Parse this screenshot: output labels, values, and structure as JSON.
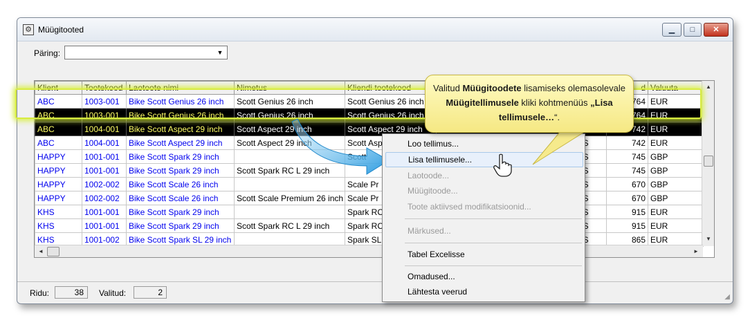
{
  "window": {
    "title": "Müügitooted",
    "minimize": "▁",
    "maximize": "□",
    "close": "✕"
  },
  "query": {
    "label": "Päring:",
    "value": ""
  },
  "grid": {
    "columns": [
      "Klient",
      "Tootekood",
      "Laotoote nimi",
      "Nimetus",
      "Kliendi tootekood",
      "",
      "",
      "d",
      "Valuuta"
    ],
    "rows": [
      {
        "klient": "ABC",
        "kood": "1003-001",
        "laonimi": "Bike Scott Genius 26 inch",
        "nimetus": "Scott Genius 26 inch",
        "kkood": "Scott Genius 26 inch",
        "c": "",
        "hind": "764",
        "valuuta": "EUR"
      },
      {
        "klient": "ABC",
        "kood": "1003-001",
        "laonimi": "Bike Scott Genius 26 inch",
        "nimetus": "Scott Genius 26 inch",
        "kkood": "Scott Genius 26 inch",
        "c": "",
        "hind": "764",
        "valuuta": "EUR"
      },
      {
        "klient": "ABC",
        "kood": "1004-001",
        "laonimi": "Bike Scott Aspect 29 inch",
        "nimetus": "Scott Aspect 29 inch",
        "kkood": "Scott Aspect 29 inch",
        "c": "",
        "hind": "742",
        "valuuta": "EUR"
      },
      {
        "klient": "ABC",
        "kood": "1004-001",
        "laonimi": "Bike Scott Aspect 29 inch",
        "nimetus": "Scott Aspect 29 inch",
        "kkood": "Scott Asp",
        "c": "CS",
        "hind": "742",
        "valuuta": "EUR"
      },
      {
        "klient": "HAPPY",
        "kood": "1001-001",
        "laonimi": "Bike Scott Spark 29 inch",
        "nimetus": "",
        "kkood": "Scott",
        "c": "CS",
        "hind": "745",
        "valuuta": "GBP"
      },
      {
        "klient": "HAPPY",
        "kood": "1001-001",
        "laonimi": "Bike Scott Spark 29 inch",
        "nimetus": "Scott Spark RC L 29 inch",
        "kkood": "",
        "c": "CS",
        "hind": "745",
        "valuuta": "GBP"
      },
      {
        "klient": "HAPPY",
        "kood": "1002-002",
        "laonimi": "Bike Scott Scale 26 inch",
        "nimetus": "",
        "kkood": "Scale Pr",
        "c": "CS",
        "hind": "670",
        "valuuta": "GBP"
      },
      {
        "klient": "HAPPY",
        "kood": "1002-002",
        "laonimi": "Bike Scott Scale 26 inch",
        "nimetus": "Scott Scale Premium 26 inch",
        "kkood": "Scale Pr",
        "c": "CS",
        "hind": "670",
        "valuuta": "GBP"
      },
      {
        "klient": "KHS",
        "kood": "1001-001",
        "laonimi": "Bike Scott Spark 29 inch",
        "nimetus": "",
        "kkood": "Spark RC",
        "c": "CS",
        "hind": "915",
        "valuuta": "EUR"
      },
      {
        "klient": "KHS",
        "kood": "1001-001",
        "laonimi": "Bike Scott Spark 29 inch",
        "nimetus": "Scott Spark RC L 29 inch",
        "kkood": "Spark RC",
        "c": "CS",
        "hind": "915",
        "valuuta": "EUR"
      },
      {
        "klient": "KHS",
        "kood": "1001-002",
        "laonimi": "Bike Scott Spark SL 29 inch",
        "nimetus": "",
        "kkood": "Spark SL",
        "c": "CS",
        "hind": "865",
        "valuuta": "EUR"
      }
    ]
  },
  "status": {
    "rows_label": "Ridu:",
    "rows_value": "38",
    "selected_label": "Valitud:",
    "selected_value": "2"
  },
  "context_menu": {
    "items": [
      {
        "label": "Loo tellimus...",
        "disabled": false
      },
      {
        "label": "Lisa tellimusele...",
        "disabled": false
      },
      {
        "label": "Laotoode...",
        "disabled": true
      },
      {
        "label": "Müügitoode...",
        "disabled": true
      },
      {
        "label": "Toote aktiivsed modifikatsioonid...",
        "disabled": true
      },
      {
        "label": "Märkused...",
        "disabled": true
      },
      {
        "label": "Tabel Excelisse",
        "disabled": false
      },
      {
        "label": "Omadused...",
        "disabled": false
      },
      {
        "label": "Lähtesta veerud",
        "disabled": false
      }
    ]
  },
  "callout": {
    "p1": "Valitud ",
    "b1": "Müügitoodete",
    "p2": " lisamiseks olemasolevale ",
    "b2": "Müügitellimusele",
    "p3": " kliki kohtmenüüs ",
    "b3": "„Lisa tellimusele…",
    "p4": "“."
  },
  "colors": {
    "selection_bg": "#000000",
    "selection_text": "#ffff66",
    "link_text": "#0000ee",
    "highlight_glow": "#d8ec3f",
    "callout_bg": "#fff6a8",
    "arrow": "#2a9be0"
  }
}
